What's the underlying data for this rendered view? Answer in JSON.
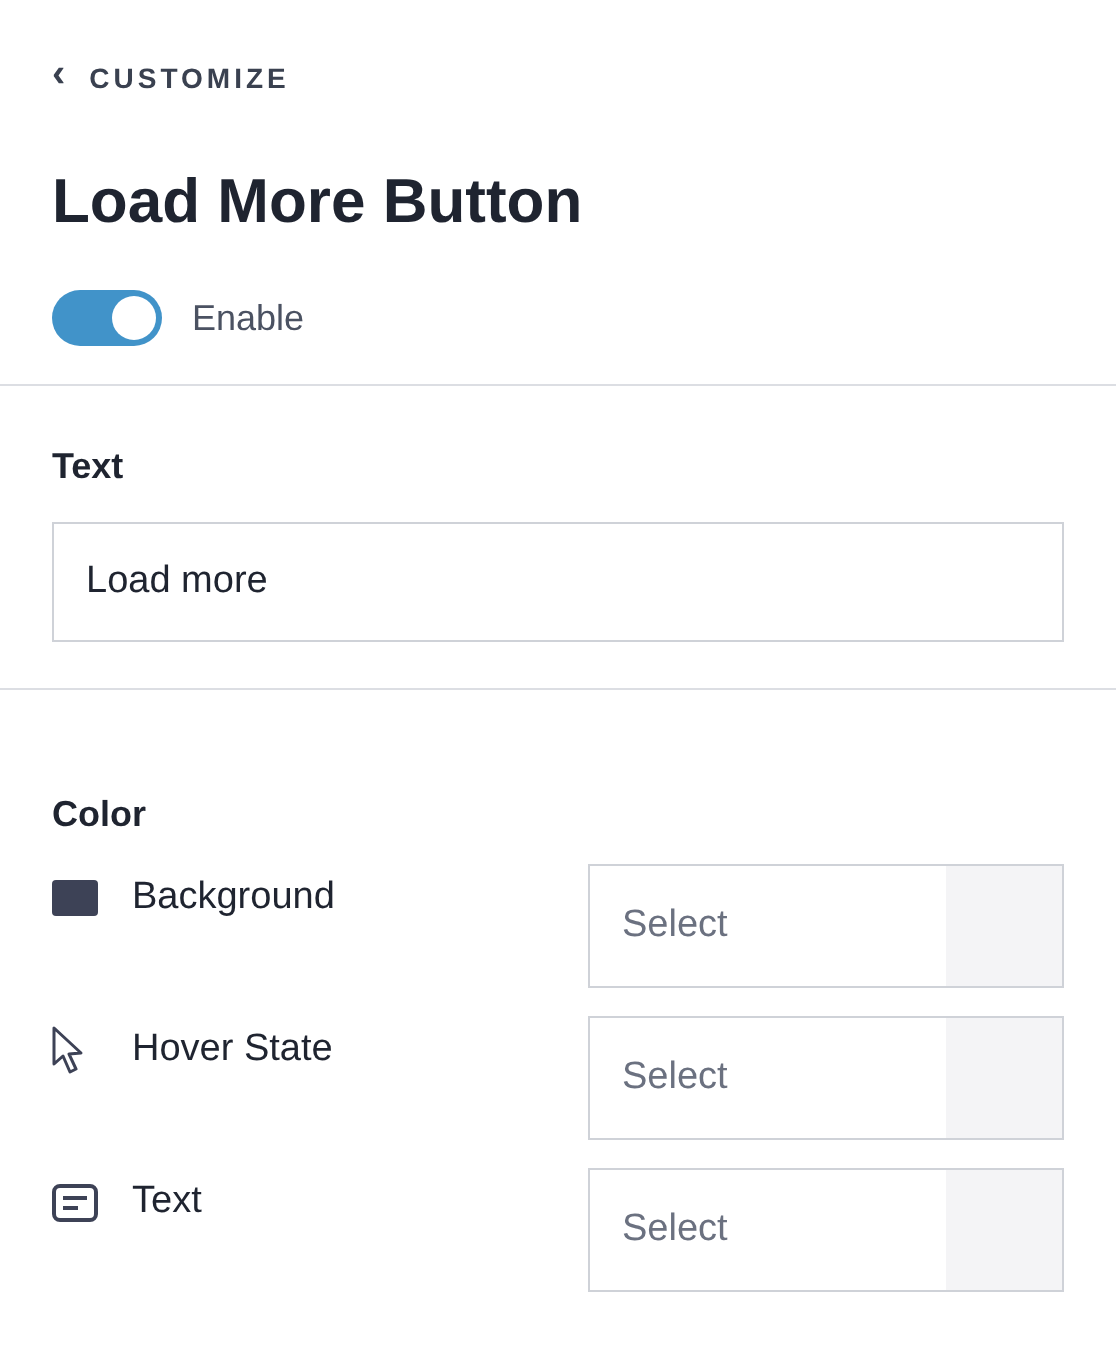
{
  "back_link": {
    "icon": "‹",
    "label": "CUSTOMIZE"
  },
  "title": "Load More Button",
  "enable": {
    "label": "Enable",
    "on": true
  },
  "text_section": {
    "label": "Text",
    "value": "Load more"
  },
  "color_section": {
    "label": "Color",
    "rows": [
      {
        "kind": "swatch",
        "label": "Background",
        "placeholder": "Select"
      },
      {
        "kind": "cursor",
        "label": "Hover State",
        "placeholder": "Select"
      },
      {
        "kind": "text",
        "label": "Text",
        "placeholder": "Select"
      }
    ]
  }
}
